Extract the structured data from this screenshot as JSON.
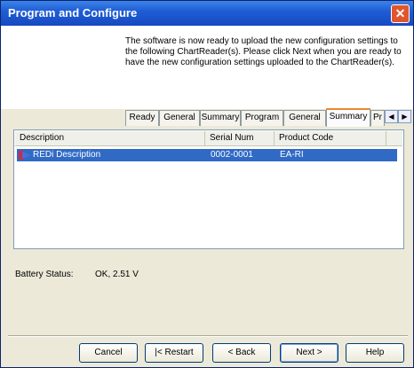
{
  "window": {
    "title": "Program and Configure"
  },
  "header": {
    "text": "The software is now ready to upload the new configuration settings to the following ChartReader(s). Please click Next when you are ready to have the new configuration settings uploaded to the ChartReader(s)."
  },
  "tabs": [
    "Ready",
    "General",
    "Summary",
    "Program",
    "General",
    "Summary",
    "Pr"
  ],
  "active_tab_index": 5,
  "list": {
    "columns": [
      "Description",
      "Serial Num",
      "Product Code"
    ],
    "rows": [
      {
        "description": "REDi Description",
        "serial": "0002-0001",
        "product_code": "EA-RI"
      }
    ]
  },
  "battery": {
    "label": "Battery Status:",
    "value": "OK, 2.51 V"
  },
  "buttons": {
    "cancel": "Cancel",
    "restart": "|< Restart",
    "back": "< Back",
    "next": "Next >",
    "help": "Help"
  },
  "colors": {
    "titlebar": "#1f5ed6",
    "selection": "#316ac5",
    "close": "#e2552b"
  }
}
